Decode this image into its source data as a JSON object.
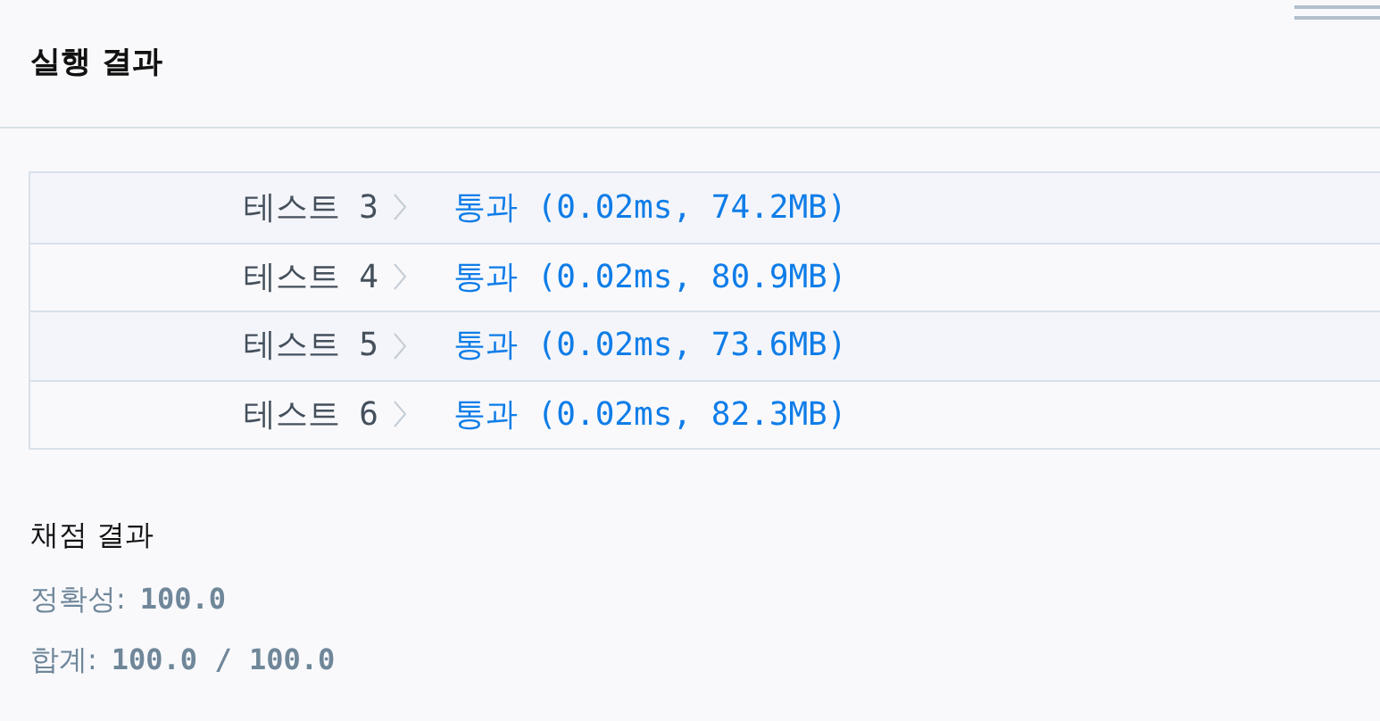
{
  "header": {
    "title": "실행 결과"
  },
  "results": [
    {
      "test": "테스트 3",
      "result": "통과 (0.02ms, 74.2MB)",
      "passed": true
    },
    {
      "test": "테스트 4",
      "result": "통과 (0.02ms, 80.9MB)",
      "passed": true
    },
    {
      "test": "테스트 5",
      "result": "통과 (0.02ms, 73.6MB)",
      "passed": true
    },
    {
      "test": "테스트 6",
      "result": "통과 (0.02ms, 82.3MB)",
      "passed": true
    }
  ],
  "score": {
    "title": "채점 결과",
    "lines": [
      {
        "label": "정확성:",
        "value": "100.0"
      },
      {
        "label": "합계:",
        "value": "100.0 / 100.0"
      }
    ]
  }
}
